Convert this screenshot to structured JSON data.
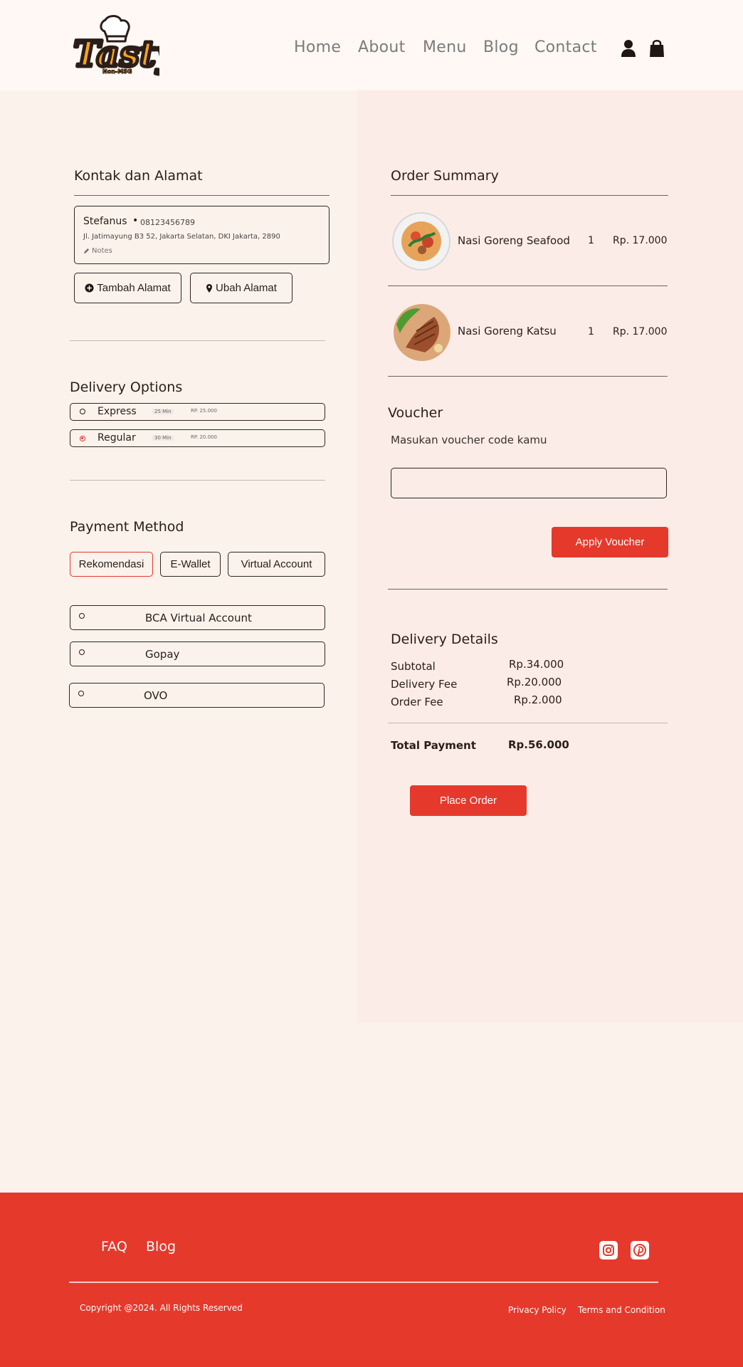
{
  "brand": {
    "logo_text": "Tasty",
    "logo_subtext": "Non-MSG"
  },
  "nav": {
    "items": [
      "Home",
      "About",
      "Menu",
      "Blog",
      "Contact"
    ],
    "icons": [
      "user-icon",
      "shopping-bag-icon"
    ]
  },
  "contact": {
    "title": "Kontak dan Alamat",
    "name": "Stefanus",
    "separator": "•",
    "phone": "08123456789",
    "address": "Jl. Jatimayung B3 52, Jakarta Selatan, DKI Jakarta, 2890",
    "notes": "Notes",
    "add_address": "Tambah Alamat",
    "change_address": "Ubah Alamat"
  },
  "delivery": {
    "title": "Delivery Options",
    "options": [
      {
        "label": "Express",
        "time": "25 Min",
        "price": "RP. 25.000",
        "selected": false
      },
      {
        "label": "Regular",
        "time": "30 Min",
        "price": "RP. 20.000",
        "selected": true
      }
    ]
  },
  "payment": {
    "title": "Payment Method",
    "tabs": [
      {
        "label": "Rekomendasi",
        "active": true
      },
      {
        "label": "E-Wallet",
        "active": false
      },
      {
        "label": "Virtual Account",
        "active": false
      }
    ],
    "methods": [
      "BCA Virtual Account",
      "Gopay",
      "OVO"
    ]
  },
  "order": {
    "title": "Order Summary",
    "items": [
      {
        "name": "Nasi Goreng Seafood",
        "qty": "1",
        "price": "Rp. 17.000"
      },
      {
        "name": "Nasi Goreng Katsu",
        "qty": "1",
        "price": "Rp. 17.000"
      }
    ]
  },
  "voucher": {
    "title": "Voucher",
    "prompt": "Masukan voucher code kamu",
    "placeholder": "",
    "button": "Apply Voucher"
  },
  "details": {
    "title": "Delivery Details",
    "rows": [
      {
        "label": "Subtotal",
        "value": "Rp.34.000"
      },
      {
        "label": "Delivery Fee",
        "value": "Rp.20.000"
      },
      {
        "label": "Order Fee",
        "value": "Rp.2.000"
      }
    ],
    "total_label": "Total Payment",
    "total_value": "Rp.56.000",
    "place_order": "Place Order"
  },
  "footer": {
    "links": [
      "FAQ",
      "Blog"
    ],
    "social_icons": [
      "instagram-icon",
      "pinterest-icon"
    ],
    "copyright": "Copyright @2024. All Rights Reserved",
    "policy_links": [
      "Privacy Policy",
      "Terms and Condition"
    ]
  },
  "colors": {
    "accent": "#e5392c",
    "header_bg": "#fff8f4",
    "page_bg": "#fbf2ec",
    "panel_bg": "#fcece7",
    "text": "#2b1d17"
  }
}
